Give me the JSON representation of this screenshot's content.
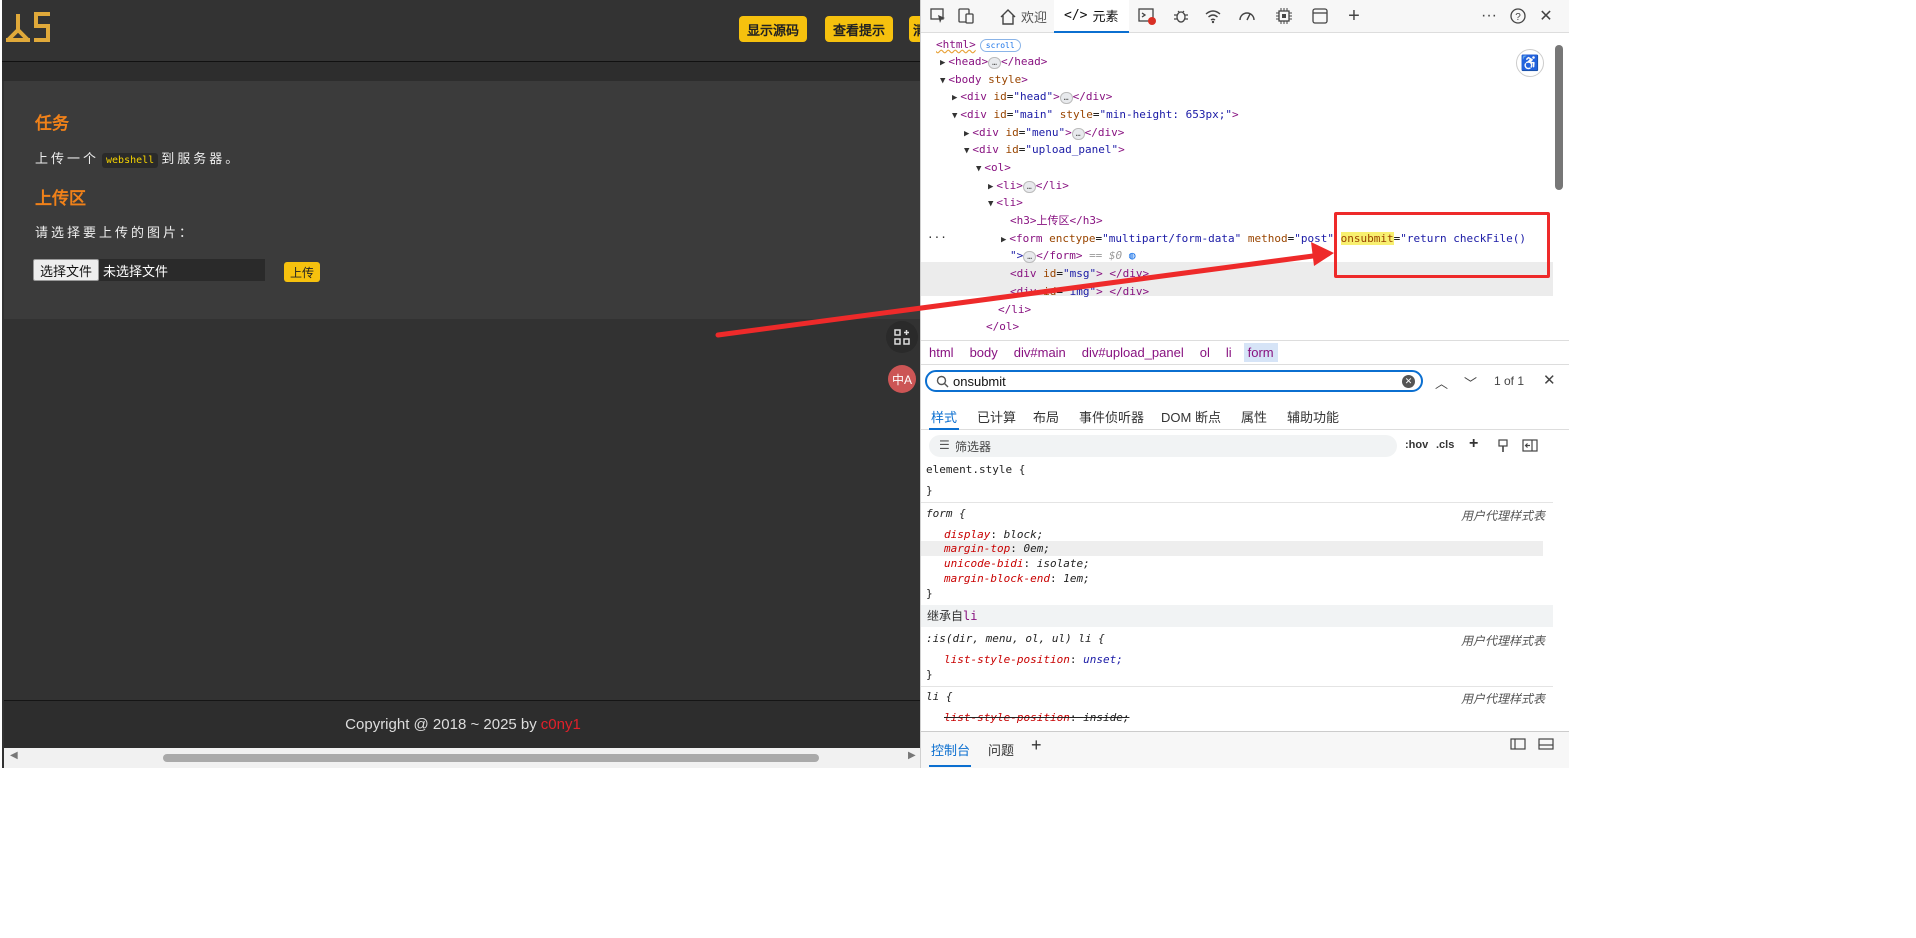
{
  "page": {
    "buttons": [
      "显示源码",
      "查看提示",
      "清"
    ],
    "task_title": "任务",
    "task_text_before": "上传一个",
    "task_code": "webshell",
    "task_text_after": "到服务器。",
    "upload_title": "上传区",
    "upload_prompt": "请选择要上传的图片：",
    "file_button": "选择文件",
    "file_status": "未选择文件",
    "upload_button": "上传",
    "footer_text": "Copyright @ 2018 ~ 2025 by",
    "footer_author": "c0ny1",
    "float_translate": "中A"
  },
  "devtools": {
    "tabs": {
      "welcome": "欢迎",
      "elements": "元素"
    },
    "dom": {
      "html": "<html>",
      "scroll_badge": "scroll",
      "head": "<head>",
      "head_close": "</head>",
      "body_open": "<body",
      "body_attr": "style",
      "body_close_bracket": ">",
      "div_head_open": "<div",
      "id_attr": "id",
      "head_id": "\"head\"",
      "div_close": "</div>",
      "main_id": "\"main\"",
      "style_attr": "style",
      "main_style": "\"min-height: 653px;\"",
      "menu_id": "\"menu\"",
      "upload_panel_id": "\"upload_panel\"",
      "ol_open": "<ol>",
      "li_open": "<li>",
      "li_close": "</li>",
      "h3": "<h3>上传区</h3>",
      "form_open": "<form",
      "enctype_attr": "enctype",
      "enctype_val": "\"multipart/form-data\"",
      "method_attr": "method",
      "method_val": "\"post\"",
      "onsubmit_attr": "onsubmit",
      "onsubmit_val": "\"return checkFile()",
      "form_tail_quote": "\">",
      "form_close": "</form>",
      "eq_dollar": "== $0",
      "msg_id": "\"msg\"",
      "img_id": "\"img\"",
      "ol_close": "</ol>",
      "ellipsis": "…",
      "row_menu": "···"
    },
    "breadcrumbs": [
      "html",
      "body",
      "div#main",
      "div#upload_panel",
      "ol",
      "li",
      "form"
    ],
    "search": {
      "value": "onsubmit",
      "count": "1 of 1"
    },
    "subtabs": [
      "样式",
      "已计算",
      "布局",
      "事件侦听器",
      "DOM 断点",
      "属性",
      "辅助功能"
    ],
    "filter": {
      "placeholder": "筛选器",
      "hov": ":hov",
      "cls": ".cls"
    },
    "styles": {
      "element_style": "element.style {",
      "close_brace": "}",
      "form_selector": "form {",
      "ua_label": "用户代理样式表",
      "form_props": [
        {
          "name": "display",
          "value": "block;"
        },
        {
          "name": "margin-top",
          "value": "0em;"
        },
        {
          "name": "unicode-bidi",
          "value": "isolate;"
        },
        {
          "name": "margin-block-end",
          "value": "1em;"
        }
      ],
      "inherited_label": "继承自",
      "inherited_tag": "li",
      "is_selector": ":is(dir, menu, ol, ul) li {",
      "is_prop": {
        "name": "list-style-position",
        "value": "unset;"
      },
      "li_selector": "li {",
      "li_prop": {
        "name": "list-style-position",
        "value": "inside;"
      }
    },
    "drawer": {
      "console": "控制台",
      "issues": "问题"
    }
  }
}
